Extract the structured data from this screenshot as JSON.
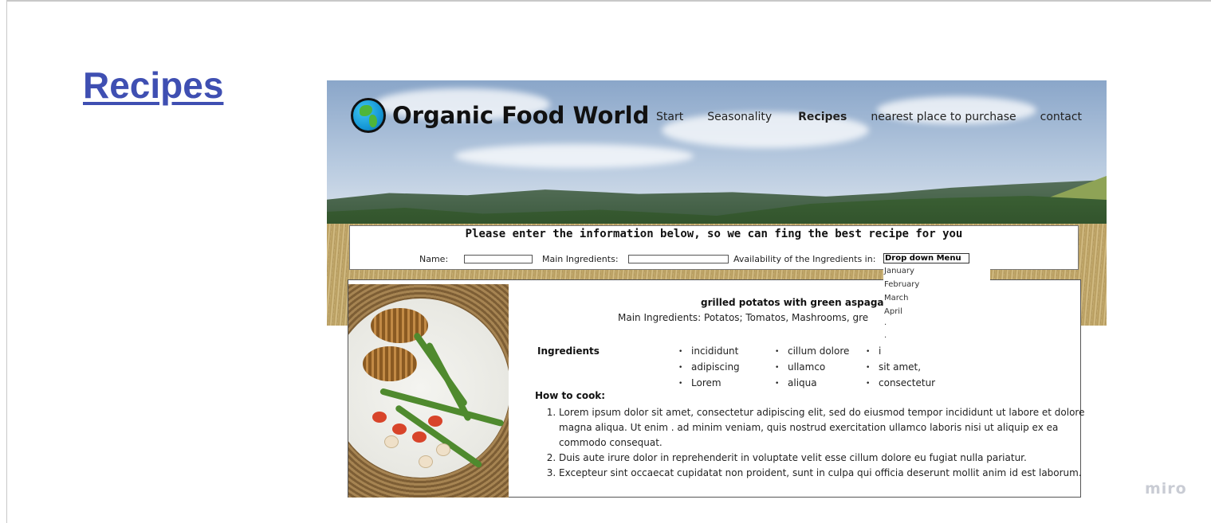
{
  "frame": {
    "title": "Recipes",
    "watermark": "miro"
  },
  "header": {
    "brand": "Organic Food World",
    "nav": [
      "Start",
      "Seasonality",
      "Recipes",
      "nearest place to purchase",
      "contact"
    ],
    "active_nav": "Recipes"
  },
  "form": {
    "heading": "Please enter the information below, so we can fing the best recipe for you",
    "name_label": "Name:",
    "ingredients_label": "Main Ingredients:",
    "availability_label": "Availability of the Ingredients in:",
    "dropdown_label": "Drop down Menu",
    "dropdown_options": [
      "January",
      "February",
      "March",
      "April",
      ".",
      "."
    ]
  },
  "recipe": {
    "title": "grilled potatos with green aspagar",
    "main_ingredients": "Main Ingredients: Potatos; Tomatos, Mashrooms, gre",
    "ingredients_heading": "Ingredients",
    "ingredient_columns": [
      [
        "incididunt",
        "adipiscing",
        "Lorem"
      ],
      [
        "cillum dolore",
        "ullamco",
        "aliqua"
      ],
      [
        "i",
        "sit amet,",
        "consectetur"
      ]
    ],
    "how_to_heading": "How to cook:",
    "steps": [
      "Lorem ipsum dolor sit amet, consectetur adipiscing elit, sed do eiusmod tempor incididunt ut labore et dolore magna aliqua. Ut enim . ad minim veniam, quis nostrud exercitation ullamco laboris nisi ut aliquip ex ea commodo consequat.",
      "Duis aute irure dolor in reprehenderit in voluptate velit esse cillum dolore eu fugiat nulla pariatur.",
      "Excepteur sint occaecat cupidatat non proident, sunt in culpa qui officia deserunt mollit anim id est laborum."
    ]
  },
  "colors": {
    "title_link": "#3f4fb2",
    "watermark": "#c9ccd4"
  }
}
